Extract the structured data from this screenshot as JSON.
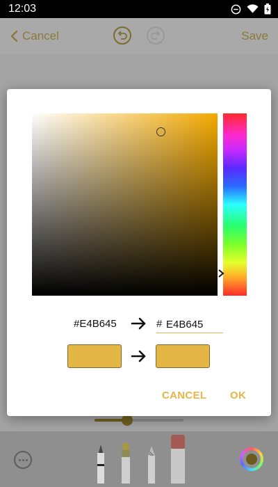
{
  "status_bar": {
    "time": "12:03",
    "icons": [
      "do-not-disturb-icon",
      "wifi-icon",
      "battery-charging-icon"
    ]
  },
  "app_bar": {
    "cancel_label": "Cancel",
    "save_label": "Save",
    "icons": [
      "chevron-left-icon",
      "undo-icon",
      "redo-icon"
    ]
  },
  "brush_size_slider": {
    "value_fraction": 0.37
  },
  "toolbar": {
    "icons": [
      "more-icon",
      "pen-icon",
      "highlighter-icon",
      "pencil-icon",
      "eraser-icon",
      "color-wheel-icon"
    ]
  },
  "color_picker": {
    "old_hex": "#E4B645",
    "hex_prefix": "#",
    "new_hex_value": "E4B645",
    "old_color": "#E4B645",
    "new_color": "#E4B645",
    "hue_color": "#F4A900",
    "cancel_label": "CANCEL",
    "ok_label": "OK"
  },
  "colors": {
    "accent": "#E4B645",
    "dim_overlay": "#A4A4A4"
  }
}
